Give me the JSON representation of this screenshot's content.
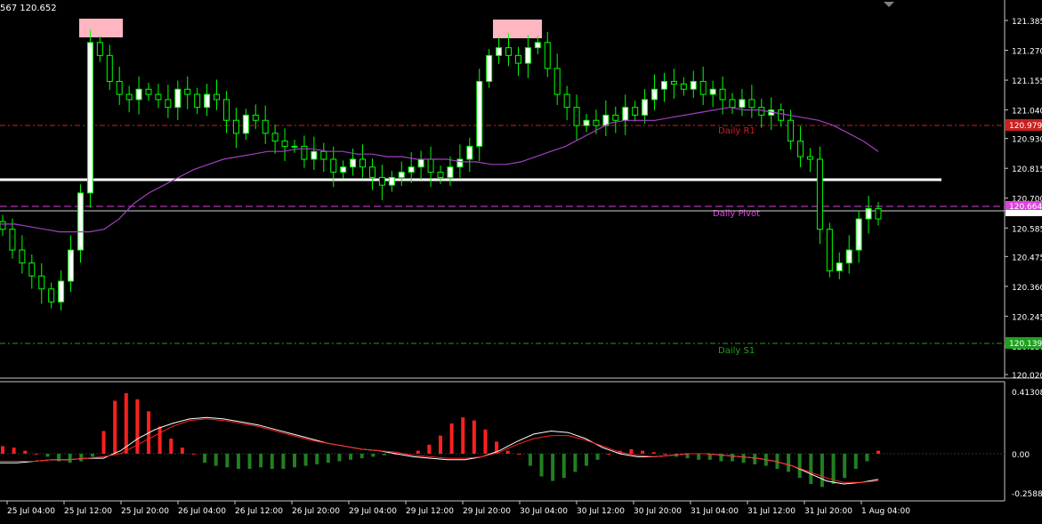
{
  "header": {
    "quote_text": "567 120.652"
  },
  "colors": {
    "background": "#000000",
    "bull_candle": "#ffffff",
    "candle_wick": "#00ff00",
    "ma_line": "#a040c0",
    "r1": "#cc2020",
    "pivot": "#e040e0",
    "s1": "#20a020",
    "macd_pos": "#ff2020",
    "macd_neg": "#208020",
    "macd_line": "#ffffff",
    "signal_line": "#ff2020",
    "swing_marker": "#ffb6c1"
  },
  "price_axis": {
    "ticks": [
      "121.385",
      "121.270",
      "121.155",
      "121.040",
      "120.930",
      "120.815",
      "120.700",
      "120.585",
      "120.475",
      "120.360",
      "120.245",
      "120.130",
      "120.020"
    ],
    "tick_values": [
      121.385,
      121.27,
      121.155,
      121.04,
      120.93,
      120.815,
      120.7,
      120.585,
      120.475,
      120.36,
      120.245,
      120.13,
      120.02
    ],
    "current_price_label": "120.652",
    "r1_label": "120.979",
    "pivot_label": "120.664",
    "s1_label": "120.139"
  },
  "levels": {
    "r1": {
      "name": "Daily R1",
      "value": 120.979
    },
    "pivot": {
      "name": "Daily Pivot",
      "value": 120.664
    },
    "s1": {
      "name": "Daily S1",
      "value": 120.139
    },
    "white_line": 120.77,
    "current_price": 120.652
  },
  "macd_axis": {
    "ticks": [
      "0.41308",
      "0.00",
      "-0.25881"
    ]
  },
  "time_axis": {
    "labels": [
      "25 Jul 04:00",
      "25 Jul 12:00",
      "25 Jul 20:00",
      "26 Jul 04:00",
      "26 Jul 12:00",
      "26 Jul 20:00",
      "29 Jul 04:00",
      "29 Jul 12:00",
      "29 Jul 20:00",
      "30 Jul 04:00",
      "30 Jul 12:00",
      "30 Jul 20:00",
      "31 Jul 04:00",
      "31 Jul 12:00",
      "31 Jul 20:00",
      "1 Aug 04:00"
    ]
  },
  "chart_data": {
    "type": "candlestick",
    "symbol": "",
    "close_path": [
      120.58,
      120.5,
      120.45,
      120.4,
      120.35,
      120.3,
      120.38,
      120.5,
      120.72,
      121.3,
      121.25,
      121.15,
      121.1,
      121.08,
      121.12,
      121.1,
      121.08,
      121.05,
      121.12,
      121.1,
      121.05,
      121.1,
      121.08,
      121.0,
      120.95,
      121.02,
      121.0,
      120.95,
      120.92,
      120.9,
      120.9,
      120.85,
      120.88,
      120.85,
      120.8,
      120.82,
      120.85,
      120.82,
      120.78,
      120.75,
      120.78,
      120.8,
      120.82,
      120.85,
      120.8,
      120.78,
      120.82,
      120.85,
      120.9,
      121.15,
      121.25,
      121.28,
      121.25,
      121.22,
      121.28,
      121.3,
      121.2,
      121.1,
      121.05,
      120.98,
      121.0,
      120.98,
      121.02,
      121.0,
      121.05,
      121.02,
      121.08,
      121.12,
      121.15,
      121.14,
      121.12,
      121.15,
      121.1,
      121.12,
      121.08,
      121.05,
      121.08,
      121.05,
      121.02,
      121.04,
      121.0,
      120.92,
      120.86,
      120.85,
      120.58,
      120.42,
      120.45,
      120.5,
      120.62,
      120.66,
      120.62
    ],
    "ma_path": [
      120.6,
      120.6,
      120.59,
      120.58,
      120.57,
      120.57,
      120.57,
      120.58,
      120.62,
      120.68,
      120.72,
      120.75,
      120.78,
      120.81,
      120.83,
      120.85,
      120.86,
      120.87,
      120.88,
      120.88,
      120.89,
      120.89,
      120.88,
      120.88,
      120.87,
      120.87,
      120.86,
      120.86,
      120.85,
      120.85,
      120.85,
      120.84,
      120.84,
      120.83,
      120.83,
      120.84,
      120.86,
      120.88,
      120.9,
      120.93,
      120.96,
      120.99,
      121.0,
      121.0,
      121.0,
      121.01,
      121.02,
      121.03,
      121.04,
      121.05,
      121.04,
      121.04,
      121.03,
      121.02,
      121.01,
      121.0,
      120.98,
      120.95,
      120.92,
      120.88
    ],
    "macd_hist": [
      0.05,
      0.04,
      0.02,
      0.0,
      -0.02,
      -0.05,
      -0.06,
      -0.05,
      -0.02,
      0.15,
      0.35,
      0.4,
      0.36,
      0.28,
      0.18,
      0.1,
      0.04,
      0.0,
      -0.06,
      -0.08,
      -0.09,
      -0.1,
      -0.1,
      -0.09,
      -0.1,
      -0.1,
      -0.09,
      -0.08,
      -0.07,
      -0.06,
      -0.05,
      -0.04,
      -0.03,
      -0.02,
      -0.01,
      0.0,
      0.0,
      0.02,
      0.06,
      0.12,
      0.2,
      0.24,
      0.22,
      0.16,
      0.08,
      0.02,
      0.0,
      -0.08,
      -0.15,
      -0.18,
      -0.16,
      -0.12,
      -0.08,
      -0.04,
      0.0,
      0.02,
      0.03,
      0.02,
      0.01,
      0.0,
      -0.02,
      -0.03,
      -0.04,
      -0.04,
      -0.05,
      -0.05,
      -0.06,
      -0.07,
      -0.08,
      -0.1,
      -0.12,
      -0.16,
      -0.2,
      -0.22,
      -0.2,
      -0.16,
      -0.1,
      -0.05,
      0.02
    ],
    "macd_line": [
      -0.06,
      -0.06,
      -0.05,
      -0.04,
      -0.04,
      -0.03,
      -0.03,
      0.02,
      0.1,
      0.16,
      0.2,
      0.23,
      0.24,
      0.23,
      0.21,
      0.19,
      0.16,
      0.13,
      0.1,
      0.07,
      0.05,
      0.03,
      0.02,
      0.0,
      -0.02,
      -0.03,
      -0.04,
      -0.04,
      -0.02,
      0.02,
      0.08,
      0.13,
      0.15,
      0.14,
      0.1,
      0.04,
      0.0,
      -0.02,
      -0.02,
      -0.01,
      0.0,
      0.0,
      -0.01,
      -0.02,
      -0.03,
      -0.05,
      -0.08,
      -0.13,
      -0.18,
      -0.2,
      -0.19,
      -0.17
    ],
    "signal_line": [
      -0.05,
      -0.05,
      -0.05,
      -0.04,
      -0.04,
      -0.03,
      -0.02,
      0.0,
      0.06,
      0.12,
      0.18,
      0.22,
      0.23,
      0.22,
      0.2,
      0.18,
      0.15,
      0.12,
      0.09,
      0.07,
      0.05,
      0.03,
      0.02,
      0.01,
      -0.01,
      -0.02,
      -0.03,
      -0.03,
      -0.02,
      0.01,
      0.06,
      0.1,
      0.12,
      0.12,
      0.09,
      0.05,
      0.01,
      -0.01,
      -0.02,
      -0.01,
      0.0,
      0.0,
      -0.01,
      -0.02,
      -0.03,
      -0.05,
      -0.08,
      -0.12,
      -0.16,
      -0.19,
      -0.19,
      -0.18
    ]
  }
}
